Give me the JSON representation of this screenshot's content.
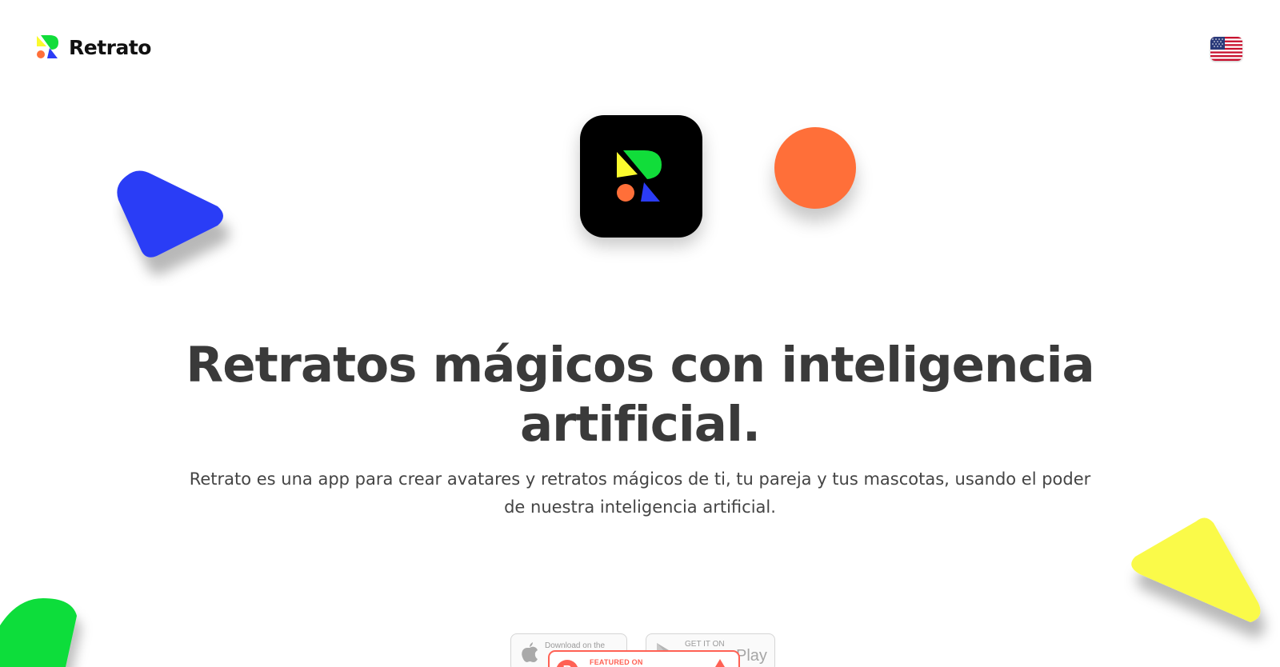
{
  "header": {
    "brand_name": "Retrato",
    "language": "English (US)"
  },
  "hero": {
    "title_line1": "Retratos mágicos con inteligencia",
    "title_line2": "artificial.",
    "subtitle_line1": "Retrato es una app para crear avatares y retratos mágicos de ti, tu pareja y tus mascotas, usando el poder",
    "subtitle_line2": "de nuestra inteligencia artificial."
  },
  "badges": {
    "app_store_small": "Download on the",
    "google_play_small": "GET IT ON",
    "google_play_big": "Play",
    "product_hunt_small": "FEATURED ON"
  },
  "colors": {
    "blue": "#2b3cf6",
    "orange": "#ff6f39",
    "yellow": "#fafa4a",
    "green": "#11dd3a",
    "product_hunt": "#ff6154"
  },
  "icons": [
    "retrato-logo-icon",
    "us-flag-icon",
    "apple-icon",
    "google-play-icon",
    "product-hunt-icon",
    "upvote-arrow-icon"
  ]
}
